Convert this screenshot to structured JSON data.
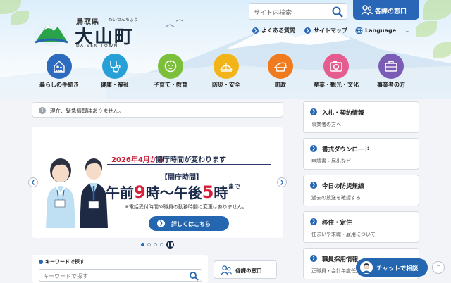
{
  "header": {
    "prefecture": "鳥取県",
    "town_kana": "だいせんちょう",
    "town_name": "大山町",
    "town_roman": "DAISEN TOWN",
    "search_placeholder": "サイト内検索",
    "departments_button": "各課の窓口",
    "util_links": [
      "よくある質問",
      "サイトマップ",
      "Language"
    ]
  },
  "categories": [
    {
      "label": "暮らしの手続き",
      "color": "#2c6bbd",
      "icon": "family-icon"
    },
    {
      "label": "健康・福祉",
      "color": "#27a0d8",
      "icon": "stethoscope-icon"
    },
    {
      "label": "子育て・教育",
      "color": "#7cbf3a",
      "icon": "baby-icon"
    },
    {
      "label": "防災・安全",
      "color": "#f2b418",
      "icon": "disaster-icon"
    },
    {
      "label": "町政",
      "color": "#f07b1f",
      "icon": "town-hall-icon"
    },
    {
      "label": "産業・観光・文化",
      "color": "#e45d8e",
      "icon": "camera-icon"
    },
    {
      "label": "事業者の方",
      "color": "#7a5bb5",
      "icon": "briefcase-icon"
    }
  ],
  "notice": {
    "text": "現在、緊急情報はありません。"
  },
  "banner": {
    "title_year": "2026年4月から",
    "title_rest": "開庁時間が変わります",
    "hours_label": "【開庁時間】",
    "hours_1": "午前",
    "hours_2": "9",
    "hours_3": "時〜午後",
    "hours_4": "5",
    "hours_5": "時",
    "hours_6": "まで",
    "note": "※電話受付時間や職員の勤務時間に変更はありません。",
    "detail_button": "詳しくはこちら"
  },
  "slider": {
    "slide_count": 4,
    "active_slide": 1
  },
  "keyword": {
    "label": "キーワードで探す",
    "placeholder": "キーワードで探す"
  },
  "departments_box": "各課の窓口",
  "right_links": [
    {
      "title": "入札・契約情報",
      "sub": "事業者の方へ"
    },
    {
      "title": "書式ダウンロード",
      "sub": "申請書・届出など"
    },
    {
      "title": "今日の防災無線",
      "sub": "過去の放送を確認する"
    },
    {
      "title": "移住・定住",
      "sub": "住まいや求職・雇用について"
    },
    {
      "title": "職員採用情報",
      "sub": "正職員・会計年度任用職員"
    }
  ],
  "chat_button": "チャットで相談",
  "colors": {
    "primary": "#2466b0",
    "accent_red": "#d71f3a"
  }
}
